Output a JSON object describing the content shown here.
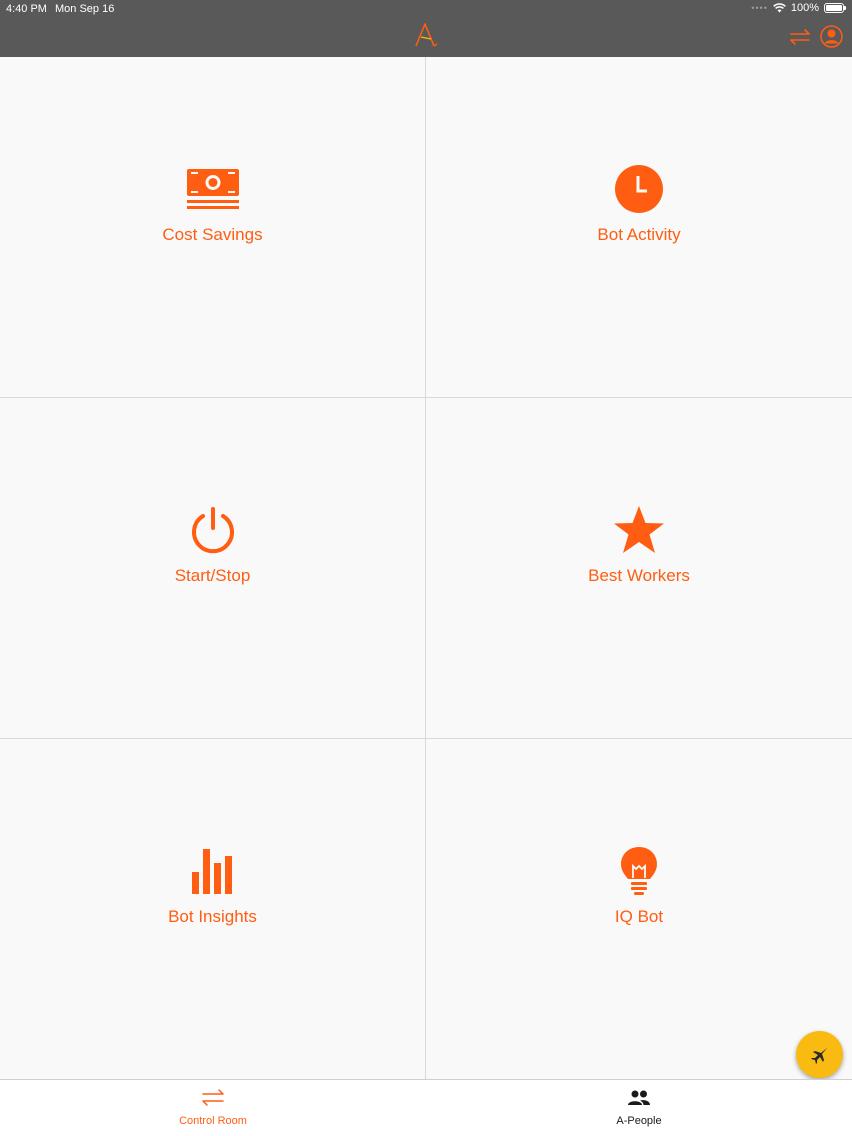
{
  "status_bar": {
    "time": "4:40 PM",
    "date": "Mon Sep 16",
    "battery": "100%"
  },
  "nav": {
    "logo": "A",
    "swap_icon": "swap-arrows-icon",
    "profile_icon": "profile-icon"
  },
  "colors": {
    "accent": "#ff5d12",
    "nav_bg": "#5a5959",
    "fab": "#f9bb12"
  },
  "tiles": [
    {
      "label": "Cost Savings",
      "icon": "money-icon"
    },
    {
      "label": "Bot Activity",
      "icon": "clock-icon"
    },
    {
      "label": "Start/Stop",
      "icon": "power-icon"
    },
    {
      "label": "Best Workers",
      "icon": "star-icon"
    },
    {
      "label": "Bot Insights",
      "icon": "bar-chart-icon"
    },
    {
      "label": "IQ Bot",
      "icon": "lightbulb-icon"
    }
  ],
  "fab": {
    "icon": "jet-icon"
  },
  "tabs": [
    {
      "label": "Control Room",
      "icon": "swap-arrows-icon",
      "selected": true
    },
    {
      "label": "A-People",
      "icon": "people-icon",
      "selected": false
    }
  ]
}
